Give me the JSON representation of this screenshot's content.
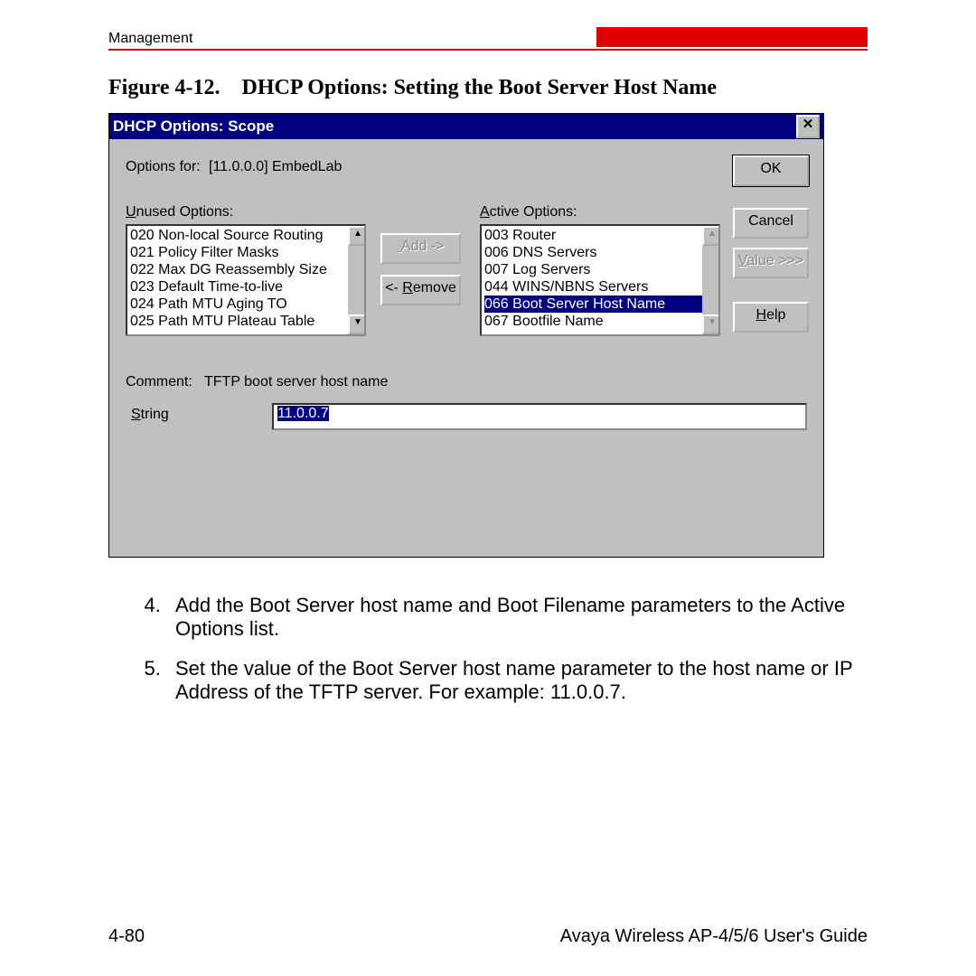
{
  "header": {
    "section": "Management"
  },
  "figure": {
    "label": "Figure 4-12.",
    "title": "DHCP Options: Setting the Boot Server Host Name"
  },
  "dialog": {
    "title": "DHCP Options: Scope",
    "options_for_label": "Options for:",
    "options_for_value": "[11.0.0.0] EmbedLab",
    "unused_label": "Unused Options:",
    "unused_items": [
      "020 Non-local Source Routing",
      "021 Policy Filter Masks",
      "022 Max DG Reassembly Size",
      "023 Default Time-to-live",
      "024 Path MTU Aging TO",
      "025 Path MTU Plateau Table"
    ],
    "active_label": "Active Options:",
    "active_items": [
      "003 Router",
      "006 DNS Servers",
      "007 Log Servers",
      "044 WINS/NBNS Servers",
      "066 Boot Server Host Name",
      "067 Bootfile Name"
    ],
    "active_selected_index": 4,
    "add_label": "Add ->",
    "remove_label": "<- Remove",
    "ok_label": "OK",
    "cancel_label": "Cancel",
    "value_label": "Value >>>",
    "help_label": "Help",
    "comment_label": "Comment:",
    "comment_value": "TFTP boot server host name",
    "string_label": "String",
    "string_value": "11.0.0.7"
  },
  "instructions": {
    "items": [
      "Add the Boot Server host name and Boot Filename parameters to the Active Options list.",
      "Set the value of the Boot Server host name parameter to the host name or IP Address of the TFTP server. For example: 11.0.0.7."
    ]
  },
  "footer": {
    "page": "4-80",
    "doc": "Avaya Wireless AP-4/5/6 User's Guide"
  }
}
